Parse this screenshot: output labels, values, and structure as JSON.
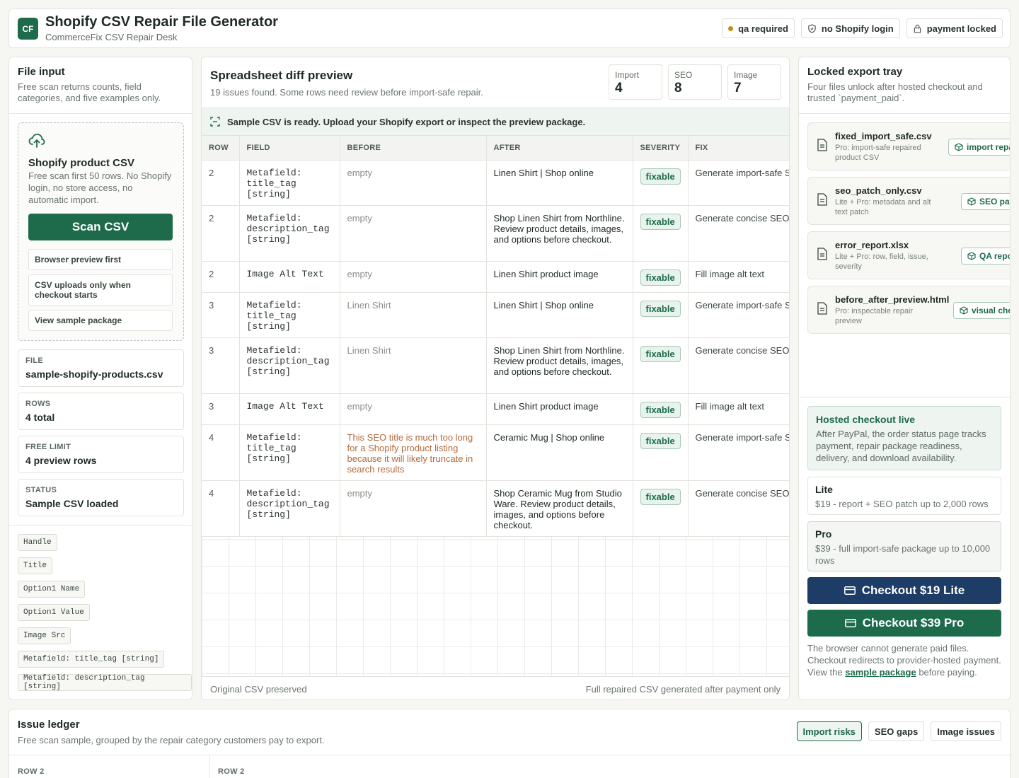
{
  "header": {
    "logo": "CF",
    "title": "Shopify CSV Repair File Generator",
    "subtitle": "CommerceFix CSV Repair Desk",
    "badges": [
      {
        "label": "qa required",
        "icon": "status-dot-icon",
        "color": "#c98a1c"
      },
      {
        "label": "no Shopify login",
        "icon": "shield-icon"
      },
      {
        "label": "payment locked",
        "icon": "lock-icon"
      }
    ]
  },
  "file_input": {
    "title": "File input",
    "subtitle": "Free scan returns counts, field categories, and five examples only.",
    "dropzone": {
      "icon": "upload-icon",
      "title": "Shopify product CSV",
      "desc": "Free scan first 50 rows. No Shopify login, no store access, no automatic import.",
      "scan_button": "Scan CSV",
      "options": [
        "Browser preview first",
        "CSV uploads only when checkout starts",
        "View sample package"
      ]
    },
    "info": [
      {
        "label": "FILE",
        "value": "sample-shopify-products.csv"
      },
      {
        "label": "ROWS",
        "value": "4 total"
      },
      {
        "label": "FREE LIMIT",
        "value": "4 preview rows"
      },
      {
        "label": "STATUS",
        "value": "Sample CSV loaded"
      }
    ],
    "fields": [
      "Handle",
      "Title",
      "Option1 Name",
      "Option1 Value",
      "Image Src",
      "Metafield: title_tag [string]",
      "Metafield: description_tag [string]"
    ]
  },
  "diff": {
    "title": "Spreadsheet diff preview",
    "subtitle": "19 issues found. Some rows need review before import-safe repair.",
    "stats": [
      {
        "label": "Import",
        "value": "4"
      },
      {
        "label": "SEO",
        "value": "8"
      },
      {
        "label": "Image",
        "value": "7"
      }
    ],
    "notice": "Sample CSV is ready. Upload your Shopify export or inspect the preview package.",
    "columns": [
      "ROW",
      "FIELD",
      "BEFORE",
      "AFTER",
      "SEVERITY",
      "FIX"
    ],
    "rows": [
      {
        "row": "2",
        "field": "Metafield: title_tag [string]",
        "before": "empty",
        "after": "Linen Shirt | Shop online",
        "severity": "fixable",
        "fix": "Generate import-safe SEO title"
      },
      {
        "row": "2",
        "field": "Metafield: description_tag [string]",
        "before": "empty",
        "after": "Shop Linen Shirt from Northline. Review product details, images, and options before checkout.",
        "severity": "fixable",
        "fix": "Generate concise SEO description"
      },
      {
        "row": "2",
        "field": "Image Alt Text",
        "before": "empty",
        "after": "Linen Shirt product image",
        "severity": "fixable",
        "fix": "Fill image alt text"
      },
      {
        "row": "3",
        "field": "Metafield: title_tag [string]",
        "before": "Linen Shirt",
        "after": "Linen Shirt | Shop online",
        "severity": "fixable",
        "fix": "Generate import-safe SEO title"
      },
      {
        "row": "3",
        "field": "Metafield: description_tag [string]",
        "before": "Linen Shirt",
        "after": "Shop Linen Shirt from Northline. Review product details, images, and options before checkout.",
        "severity": "fixable",
        "fix": "Generate concise SEO description"
      },
      {
        "row": "3",
        "field": "Image Alt Text",
        "before": "empty",
        "after": "Linen Shirt product image",
        "severity": "fixable",
        "fix": "Fill image alt text"
      },
      {
        "row": "4",
        "field": "Metafield: title_tag [string]",
        "before": "This SEO title is much too long for a Shopify product listing because it will likely truncate in search results",
        "after": "Ceramic Mug | Shop online",
        "severity": "fixable",
        "fix": "Generate import-safe SEO title"
      },
      {
        "row": "4",
        "field": "Metafield: description_tag [string]",
        "before": "empty",
        "after": "Shop Ceramic Mug from Studio Ware. Review product details, images, and options before checkout.",
        "severity": "fixable",
        "fix": "Generate concise SEO description"
      }
    ],
    "footer_left": "Original CSV preserved",
    "footer_right": "Full repaired CSV generated after payment only"
  },
  "export_tray": {
    "title": "Locked export tray",
    "subtitle": "Four files unlock after hosted checkout and trusted `payment_paid`.",
    "files": [
      {
        "name": "fixed_import_safe.csv",
        "desc": "Pro: import-safe repaired product CSV",
        "tag": "import repair"
      },
      {
        "name": "seo_patch_only.csv",
        "desc": "Lite + Pro: metadata and alt text patch",
        "tag": "SEO patch"
      },
      {
        "name": "error_report.xlsx",
        "desc": "Lite + Pro: row, field, issue, severity",
        "tag": "QA report"
      },
      {
        "name": "before_after_preview.html",
        "desc": "Pro: inspectable repair preview",
        "tag": "visual check"
      }
    ],
    "hosted": {
      "title": "Hosted checkout live",
      "body": "After PayPal, the order status page tracks payment, repair package readiness, delivery, and download availability."
    },
    "plans": [
      {
        "name": "Lite",
        "desc": "$19 - report + SEO patch up to 2,000 rows"
      },
      {
        "name": "Pro",
        "desc": "$39 - full import-safe package up to 10,000 rows"
      }
    ],
    "checkout_lite": "Checkout $19 Lite",
    "checkout_pro": "Checkout $39 Pro",
    "note_before": "The browser cannot generate paid files. Checkout redirects to provider-hosted payment. View the ",
    "note_link": "sample package",
    "note_after": " before paying."
  },
  "ledger": {
    "title": "Issue ledger",
    "subtitle": "Free scan sample, grouped by the repair category customers pay to export.",
    "tabs": [
      "Import risks",
      "SEO gaps",
      "Image issues"
    ],
    "columns": [
      "ROW 2",
      "ROW 2"
    ]
  },
  "colors": {
    "brand": "#1e6b4c",
    "navy": "#1d3d66",
    "warning": "#c98a1c"
  }
}
